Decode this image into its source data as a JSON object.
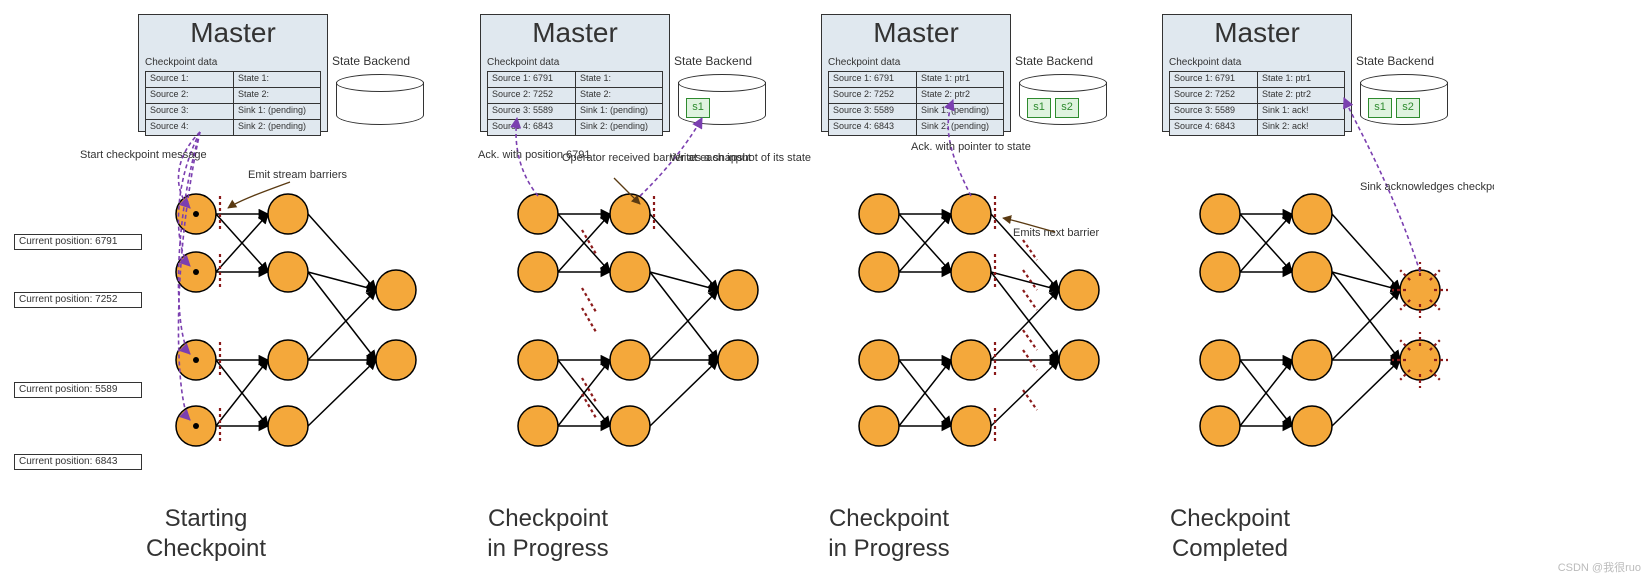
{
  "diagram_type": "process-sequence",
  "watermark": "CSDN @我很ruo",
  "stages": [
    {
      "title_l1": "Starting",
      "title_l2": "Checkpoint",
      "master": "Master",
      "ckpt_label": "Checkpoint data",
      "rows": [
        [
          "Source 1:",
          "State 1:"
        ],
        [
          "Source 2:",
          "State 2:"
        ],
        [
          "Source 3:",
          "Sink 1: (pending)"
        ],
        [
          "Source 4:",
          "Sink 2: (pending)"
        ]
      ],
      "backend": "State Backend",
      "snaps": [],
      "positions": [
        "Current position: 6791",
        "Current position: 7252",
        "Current position: 5589",
        "Current position: 6843"
      ],
      "ann": [
        "Start checkpoint message",
        "Emit stream barriers"
      ]
    },
    {
      "title_l1": "Checkpoint",
      "title_l2": "in Progress",
      "master": "Master",
      "ckpt_label": "Checkpoint data",
      "rows": [
        [
          "Source 1: 6791",
          "State 1:"
        ],
        [
          "Source 2: 7252",
          "State 2:"
        ],
        [
          "Source 3: 5589",
          "Sink 1: (pending)"
        ],
        [
          "Source 4: 6843",
          "Sink 2: (pending)"
        ]
      ],
      "backend": "State Backend",
      "snaps": [
        "s1"
      ],
      "ann": [
        "Ack. with position 6791",
        "Operator received barrier at each input",
        "Writes a snapshot of its state"
      ]
    },
    {
      "title_l1": "Checkpoint",
      "title_l2": "in Progress",
      "master": "Master",
      "ckpt_label": "Checkpoint data",
      "rows": [
        [
          "Source 1: 6791",
          "State 1: ptr1"
        ],
        [
          "Source 2: 7252",
          "State 2: ptr2"
        ],
        [
          "Source 3: 5589",
          "Sink 1: (pending)"
        ],
        [
          "Source 4: 6843",
          "Sink 2: (pending)"
        ]
      ],
      "backend": "State Backend",
      "snaps": [
        "s1",
        "s2"
      ],
      "ann": [
        "Ack. with pointer to state",
        "Emits next barrier"
      ]
    },
    {
      "title_l1": "Checkpoint",
      "title_l2": "Completed",
      "master": "Master",
      "ckpt_label": "Checkpoint data",
      "rows": [
        [
          "Source 1: 6791",
          "State 1: ptr1"
        ],
        [
          "Source 2: 7252",
          "State 2: ptr2"
        ],
        [
          "Source 3: 5589",
          "Sink 1: ack!"
        ],
        [
          "Source 4: 6843",
          "Sink 2: ack!"
        ]
      ],
      "backend": "State Backend",
      "snaps": [
        "s1",
        "s2"
      ],
      "ann": [
        "Sink acknowledges checkpoint after receiving all barriers"
      ]
    }
  ]
}
